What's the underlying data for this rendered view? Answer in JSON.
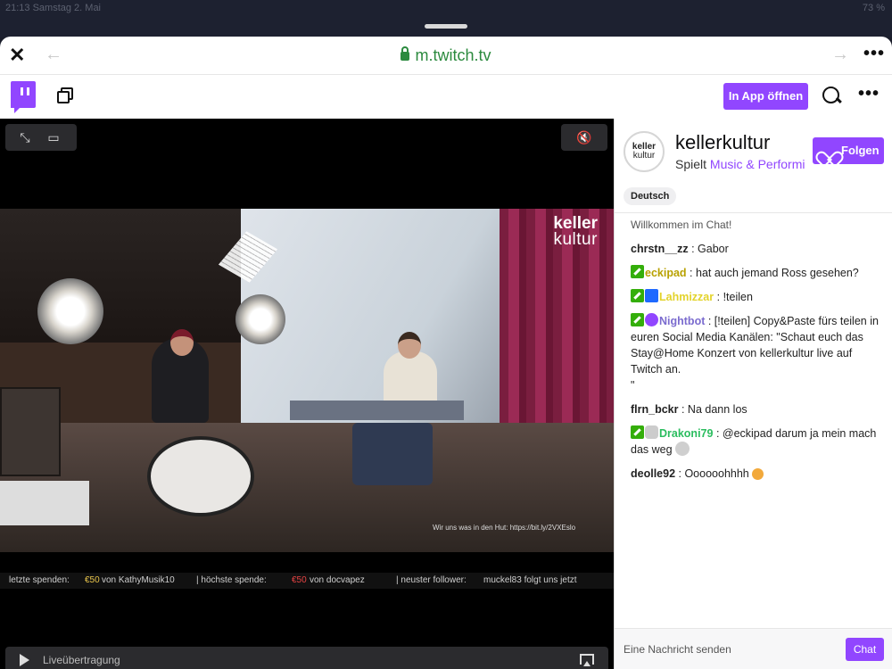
{
  "status_bar": {
    "time": "21:13 Samstag 2. Mai",
    "battery": "73 %"
  },
  "browser": {
    "url": "m.twitch.tv",
    "close_glyph": "✕",
    "back_glyph": "←",
    "forward_glyph": "→",
    "more_glyph": "•••"
  },
  "twitch_bar": {
    "open_app_label": "In App öffnen",
    "more_glyph": "•••"
  },
  "video": {
    "expand_glyph": "⤡",
    "pip_glyph": "▭",
    "mute_glyph": "🔇",
    "brand_line1": "keller",
    "brand_line2": "kultur",
    "overlay_url": "Wir uns was in den Hut: https://bit.ly/2VXEslo",
    "ticker": {
      "label1": "letzte spenden:",
      "amount1": "€50",
      "donor1": "von KathyMusik10",
      "label2": "| höchste spende:",
      "amount2": "€50",
      "donor2": "von docvapez",
      "label3": "| neuster follower:",
      "follower": "muckel83 folgt uns jetzt"
    },
    "live_label": "Liveübertragung"
  },
  "channel": {
    "avatar_line1": "keller",
    "avatar_line2": "kultur",
    "name": "kellerkultur",
    "playing_prefix": "Spielt",
    "game": "Music & Performing Arts",
    "follow_label": "Folgen",
    "language_tag": "Deutsch"
  },
  "chat": {
    "welcome": "Willkommen im Chat!",
    "messages": [
      {
        "user": "chrstn__zz",
        "color": "#0e0e10",
        "text": ": Gabor"
      },
      {
        "user": "eckipad",
        "color": "#b8a100",
        "text": ": hat auch jemand Ross gesehen?"
      },
      {
        "user": "Lahmizzar",
        "color": "#e3d32b",
        "text": ": !teilen"
      },
      {
        "user": "Nightbot",
        "color": "#7b6ccf",
        "text": ": [!teilen] Copy&Paste fürs teilen in euren Social Media Kanälen: \"Schaut euch das Stay@Home Konzert von kellerkultur live auf Twitch an.",
        "text2": "\""
      },
      {
        "user": "flrn_bckr",
        "color": "#0e0e10",
        "text": ": Na dann los"
      },
      {
        "user": "Drakoni79",
        "color": "#2bbd5f",
        "text": ": @eckipad darum ja mein mach das weg"
      },
      {
        "user": "deolle92",
        "color": "#0e0e10",
        "text": ": Oooooohhhh"
      }
    ],
    "input_placeholder": "Eine Nachricht senden",
    "send_label": "Chat"
  },
  "colors": {
    "brand": "#9146ff",
    "url_green": "#2b8a3e",
    "mod_badge": "#34ae0a"
  }
}
